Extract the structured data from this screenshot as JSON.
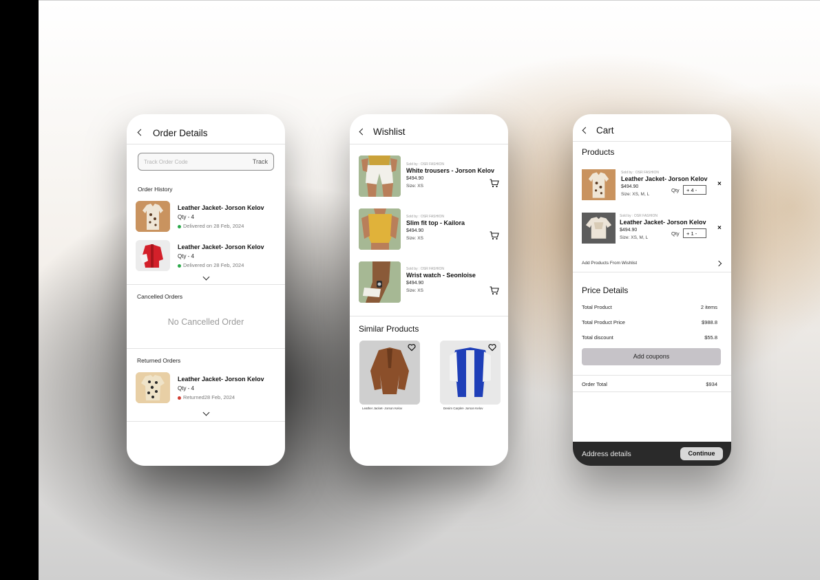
{
  "colors": {
    "accent_delivered": "#2ba84a",
    "accent_returned": "#d03b2f",
    "coupon_bg": "#c6c3c8",
    "footer_bg": "#2a2a2a"
  },
  "order_details": {
    "title": "Order Details",
    "track_placeholder": "Track Order Code",
    "track_button": "Track",
    "order_history_label": "Order History",
    "orders": [
      {
        "name": "Leather Jacket- Jorson Kelov",
        "qty": "Qty - 4",
        "status": "Delivered on 28 Feb, 2024"
      },
      {
        "name": "Leather Jacket- Jorson Kelov",
        "qty": "Qty - 4",
        "status": "Delivered on 28 Feb, 2024"
      }
    ],
    "cancelled_label": "Cancelled Orders",
    "no_cancelled": "No Cancelled Order",
    "returned_label": "Returned Orders",
    "returned": [
      {
        "name": "Leather Jacket- Jorson Kelov",
        "qty": "Qty - 4",
        "status": "Returned28 Feb, 2024"
      }
    ]
  },
  "wishlist": {
    "title": "Wishlist",
    "items": [
      {
        "sold_by": "Sold by : OSR FASHION",
        "name": "White trousers - Jorson Kelov",
        "price": "$494.90",
        "size": "Size: XS"
      },
      {
        "sold_by": "Sold by : OSR FASHION",
        "name": "Slim fit top - Kailora",
        "price": "$494.90",
        "size": "Size: XS"
      },
      {
        "sold_by": "Sold by : OSR FASHION",
        "name": "Wrist watch - Seonloise",
        "price": "$494.90",
        "size": "Size: XS"
      }
    ],
    "similar_title": "Similar Products",
    "similar": [
      {
        "caption": "Leather Jacket- Jorson Kelov"
      },
      {
        "caption": "Denim Carplet- Jorson Kelov"
      }
    ]
  },
  "cart": {
    "title": "Cart",
    "products_label": "Products",
    "items": [
      {
        "sold_by": "Sold by : OSR FASHION",
        "name": "Leather Jacket- Jorson Kelov",
        "price": "$494.90",
        "size": "Size: XS, M, L",
        "qty_label": "Qty",
        "qty": "+ 4 -"
      },
      {
        "sold_by": "Sold by : OSR FASHION",
        "name": "Leather Jacket- Jorson Kelov",
        "price": "$494.90",
        "size": "Size: XS, M, L",
        "qty_label": "Qty",
        "qty": "+ 1 -"
      }
    ],
    "remove_symbol": "×",
    "add_from_wishlist": "Add Products From Wishlist",
    "price_details_title": "Price Details",
    "rows": [
      {
        "label": "Total Product",
        "value": "2 items"
      },
      {
        "label": "Total Product Price",
        "value": "$988.8"
      },
      {
        "label": "Total discount",
        "value": "$55.8"
      }
    ],
    "coupon_button": "Add coupons",
    "order_total_label": "Order Total",
    "order_total_value": "$934",
    "footer_label": "Address details",
    "continue_button": "Continue"
  }
}
